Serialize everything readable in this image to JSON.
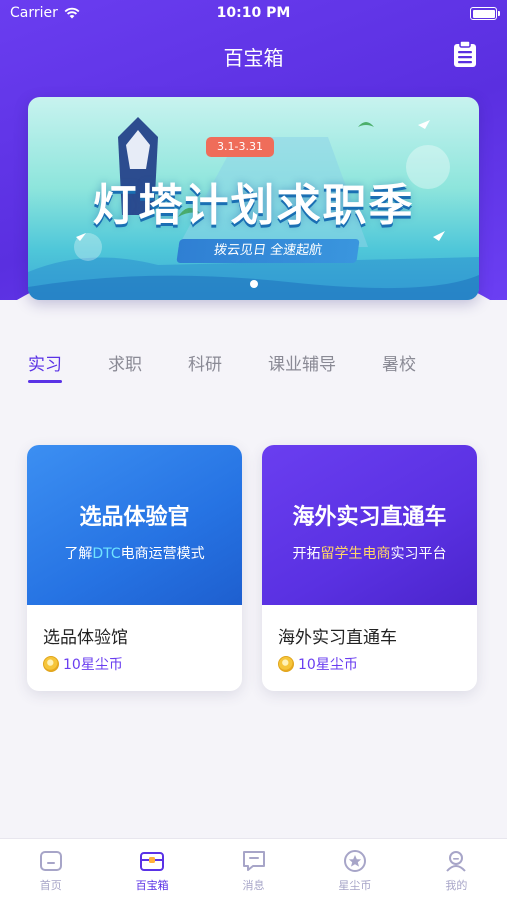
{
  "status": {
    "carrier": "Carrier",
    "time": "10:10 PM"
  },
  "header": {
    "title": "百宝箱"
  },
  "banner": {
    "date_range": "3.1-3.31",
    "headline": "灯塔计划求职季",
    "tagline": "拨云见日 全速起航"
  },
  "tabs": [
    "实习",
    "求职",
    "科研",
    "课业辅导",
    "暑校"
  ],
  "cards": [
    {
      "cover_title": "选品体验官",
      "cover_sub_pre": "了解",
      "cover_sub_hl": "DTC",
      "cover_sub_post": "电商运营模式",
      "name": "选品体验馆",
      "price": "10星尘币"
    },
    {
      "cover_title": "海外实习直通车",
      "cover_sub_pre": "开拓",
      "cover_sub_hl": "留学生电商",
      "cover_sub_post": "实习平台",
      "name": "海外实习直通车",
      "price": "10星尘币"
    }
  ],
  "tabbar": [
    {
      "label": "首页",
      "icon": "home-icon"
    },
    {
      "label": "百宝箱",
      "icon": "toolbox-icon"
    },
    {
      "label": "消息",
      "icon": "message-icon"
    },
    {
      "label": "星尘币",
      "icon": "star-coin-icon"
    },
    {
      "label": "我的",
      "icon": "profile-icon"
    }
  ],
  "colors": {
    "accent": "#5a32e6",
    "inactive": "#a7a5c8"
  }
}
